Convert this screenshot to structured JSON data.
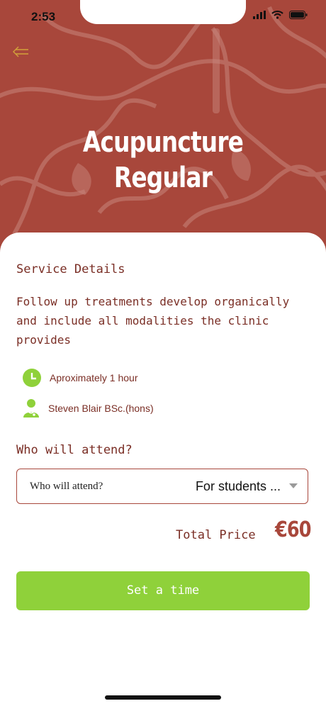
{
  "status": {
    "time": "2:53"
  },
  "hero": {
    "title_line1": "Acupuncture",
    "title_line2": "Regular",
    "back_icon": "back-arrow-icon"
  },
  "service": {
    "section_title": "Service Details",
    "description": "Follow up treatments develop organically and include all modalities the clinic provides",
    "duration": "Aproximately 1 hour",
    "practitioner": "Steven Blair BSc.(hons)"
  },
  "attend": {
    "title": "Who will attend?",
    "select_label": "Who will attend?",
    "select_value": "For students ..."
  },
  "price": {
    "label": "Total Price",
    "value": "€60"
  },
  "cta": {
    "label": "Set a time"
  },
  "colors": {
    "brand": "#a8473b",
    "accent_green": "#8fd13a",
    "text_dark_red": "#7a2e25"
  }
}
